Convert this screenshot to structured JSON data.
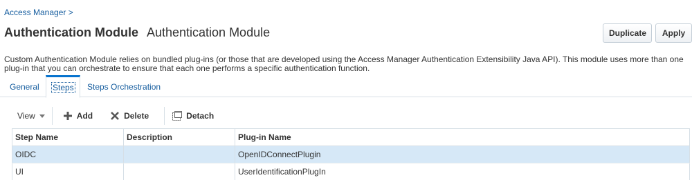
{
  "breadcrumb": {
    "label": "Access Manager >"
  },
  "header": {
    "title": "Authentication Module",
    "subtitle": "Authentication Module",
    "duplicate_label": "Duplicate",
    "apply_label": "Apply"
  },
  "description": "Custom Authentication Module relies on bundled plug-ins (or those that are developed using the Access Manager Authentication Extensibility Java API). This module uses more than one plug-in that you can orchestrate to ensure that each one performs a specific authentication function.",
  "tabs": [
    {
      "label": "General",
      "selected": false
    },
    {
      "label": "Steps",
      "selected": true
    },
    {
      "label": "Steps Orchestration",
      "selected": false
    }
  ],
  "toolbar": {
    "view_label": "View",
    "add_label": "Add",
    "delete_label": "Delete",
    "detach_label": "Detach"
  },
  "table": {
    "columns": [
      "Step Name",
      "Description",
      "Plug-in Name"
    ],
    "rows": [
      {
        "step_name": "OIDC",
        "description": "",
        "plugin_name": "OpenIDConnectPlugin",
        "selected": true
      },
      {
        "step_name": "UI",
        "description": "",
        "plugin_name": "UserIdentificationPlugIn",
        "selected": false
      }
    ]
  },
  "colors": {
    "link": "#145c9e",
    "selected_row": "#d6e8f7",
    "tab_accent": "#0572ce"
  }
}
